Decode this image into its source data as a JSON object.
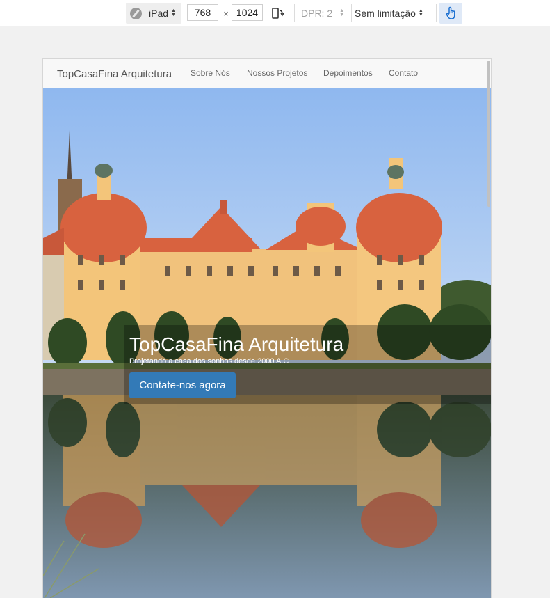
{
  "toolbar": {
    "device": "iPad",
    "width": "768",
    "times": "×",
    "height": "1024",
    "dpr": "DPR: 2",
    "throttle": "Sem limitação",
    "icons": [
      "compass-icon",
      "rotate-icon",
      "touch-hand-icon"
    ]
  },
  "site": {
    "brand": "TopCasaFina Arquitetura",
    "nav": [
      "Sobre Nós",
      "Nossos Projetos",
      "Depoimentos",
      "Contato"
    ],
    "hero": {
      "title": "TopCasaFina Arquitetura",
      "subtitle": "Projetando a casa dos sonhos desde 2000 A.C",
      "button": "Contate-nos agora"
    }
  },
  "colors": {
    "button": "#337ab7",
    "navbar": "#f8f8f8",
    "sky": "#8fb8ea",
    "roof": "#d8623f",
    "walls": "#f2c47a"
  }
}
